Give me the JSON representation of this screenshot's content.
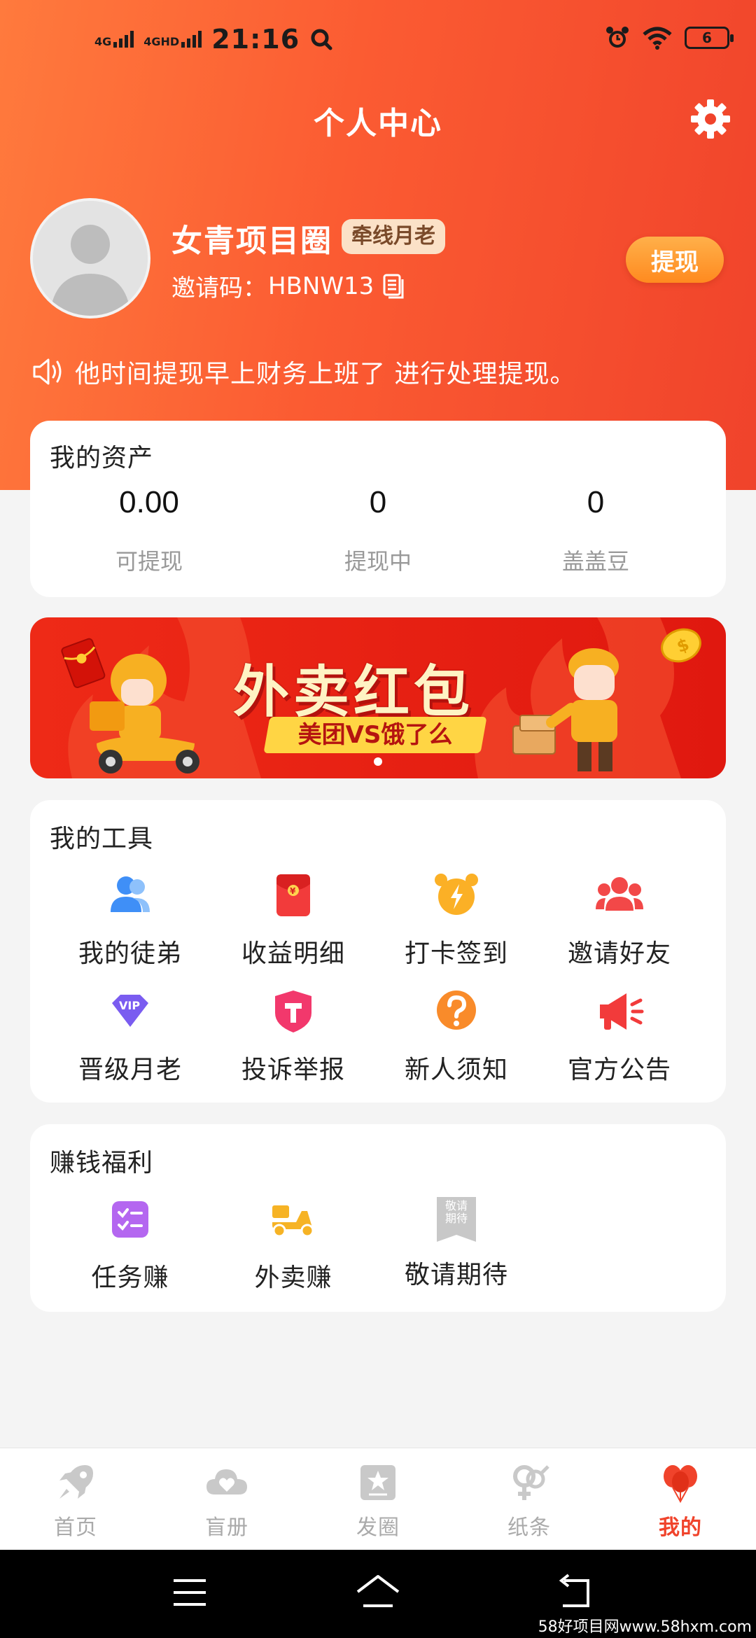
{
  "status_bar": {
    "network1": "4G",
    "network2": "4GHD",
    "time": "21:16",
    "battery": "6"
  },
  "header": {
    "title": "个人中心"
  },
  "profile": {
    "username": "女青项目圈",
    "level_badge": "牵线月老",
    "invite_label": "邀请码：",
    "invite_code": "HBNW13",
    "withdraw_label": "提现"
  },
  "notice": {
    "text": "他时间提现早上财务上班了 进行处理提现。"
  },
  "assets": {
    "title": "我的资产",
    "items": [
      {
        "value": "0.00",
        "label": "可提现"
      },
      {
        "value": "0",
        "label": "提现中"
      },
      {
        "value": "0",
        "label": "盖盖豆"
      }
    ]
  },
  "banner": {
    "title": "外卖红包",
    "subtitle": "美团VS饿了么"
  },
  "tools": {
    "title": "我的工具",
    "items": [
      {
        "label": "我的徒弟",
        "icon": "people-icon"
      },
      {
        "label": "收益明细",
        "icon": "red-envelope-icon"
      },
      {
        "label": "打卡签到",
        "icon": "alarm-clock-icon"
      },
      {
        "label": "邀请好友",
        "icon": "group-icon"
      },
      {
        "label": "晋级月老",
        "icon": "vip-icon"
      },
      {
        "label": "投诉举报",
        "icon": "shield-t-icon"
      },
      {
        "label": "新人须知",
        "icon": "question-icon"
      },
      {
        "label": "官方公告",
        "icon": "megaphone-icon"
      }
    ]
  },
  "welfare": {
    "title": "赚钱福利",
    "items": [
      {
        "label": "任务赚",
        "icon": "checklist-icon"
      },
      {
        "label": "外卖赚",
        "icon": "scooter-icon"
      },
      {
        "label": "敬请期待",
        "icon": "bookmark-icon",
        "icon_text": "敬请期待"
      }
    ]
  },
  "tabbar": {
    "items": [
      {
        "label": "首页",
        "icon": "rocket-icon"
      },
      {
        "label": "盲册",
        "icon": "cloud-heart-icon"
      },
      {
        "label": "发圈",
        "icon": "star-box-icon"
      },
      {
        "label": "纸条",
        "icon": "gender-icon"
      },
      {
        "label": "我的",
        "icon": "balloons-icon",
        "active": true
      }
    ]
  },
  "watermark": "58好项目网www.58hxm.com",
  "colors": {
    "header_start": "#ff7a3d",
    "header_end": "#f0432b",
    "active_tab": "#f0432b",
    "badge_bg": "#fbe1c7",
    "withdraw_btn": "#ff8a1f"
  }
}
